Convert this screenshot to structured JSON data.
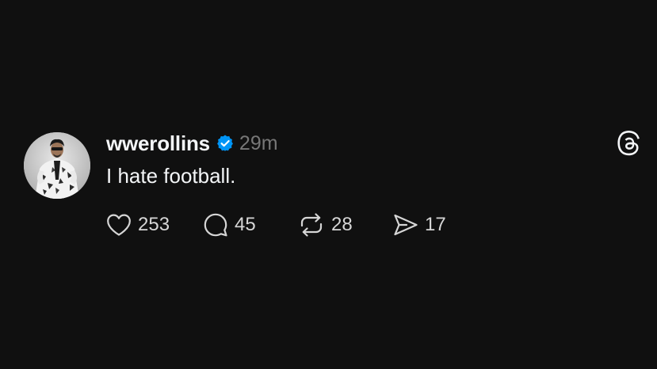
{
  "post": {
    "username": "wwerollins",
    "timestamp": "29m",
    "text": "I hate football.",
    "avatar_icon": "user-avatar-photo",
    "verified_icon": "verified-badge-icon",
    "app_icon": "threads-logo-icon"
  },
  "actions": {
    "likes": "253",
    "comments": "45",
    "reposts": "28",
    "shares": "17"
  },
  "colors": {
    "background": "#101010",
    "text_primary": "#f3f5f7",
    "text_secondary": "#777777",
    "verified_blue": "#0095f6",
    "icon": "#d6d6d6"
  }
}
